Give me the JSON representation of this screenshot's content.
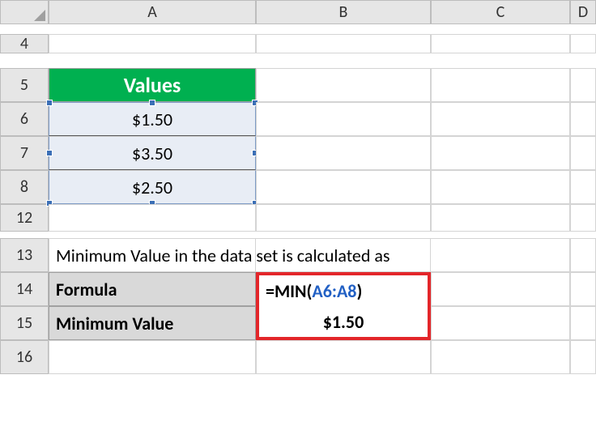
{
  "columns": {
    "A": "A",
    "B": "B",
    "C": "C",
    "D": "D"
  },
  "rows": {
    "r4": "4",
    "r5": "5",
    "r6": "6",
    "r7": "7",
    "r8": "8",
    "r12": "12",
    "r13": "13",
    "r14": "14",
    "r15": "15",
    "r16": "16"
  },
  "header": {
    "values_label": "Values"
  },
  "values": {
    "v1": "$1.50",
    "v2": "$3.50",
    "v3": "$2.50"
  },
  "description": "Minimum Value in the data set is calculated as",
  "labels": {
    "formula": "Formula",
    "minvalue": "Minimum Value"
  },
  "formula": {
    "prefix": "=MIN(",
    "ref": "A6:A8",
    "suffix": ")"
  },
  "result": "$1.50"
}
